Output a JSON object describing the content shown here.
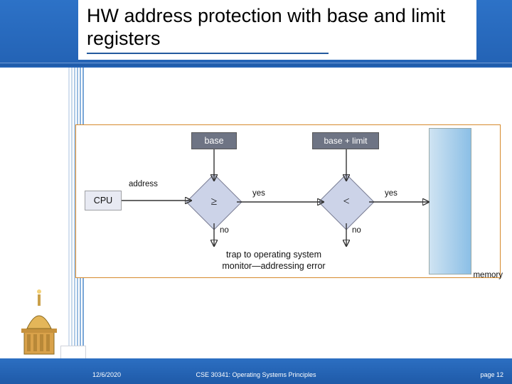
{
  "title": "HW address protection with base and limit registers",
  "diagram": {
    "register_base": "base",
    "register_base_limit": "base + limit",
    "cpu_label": "CPU",
    "memory_label": "memory",
    "op_ge": "≥",
    "op_lt": "<",
    "edge_address": "address",
    "edge_yes": "yes",
    "edge_no": "no",
    "trap_line1": "trap to operating system",
    "trap_line2": "monitor—addressing error"
  },
  "footer": {
    "date": "12/6/2020",
    "course": "CSE 30341: Operating Systems Principles",
    "page_label": "page 12"
  },
  "colors": {
    "header_blue": "#2362b4",
    "diagram_border": "#d68a2c",
    "register_fill": "#6e7484",
    "memory_gradient_start": "#cfe3f2",
    "memory_gradient_end": "#8bbfe6"
  }
}
